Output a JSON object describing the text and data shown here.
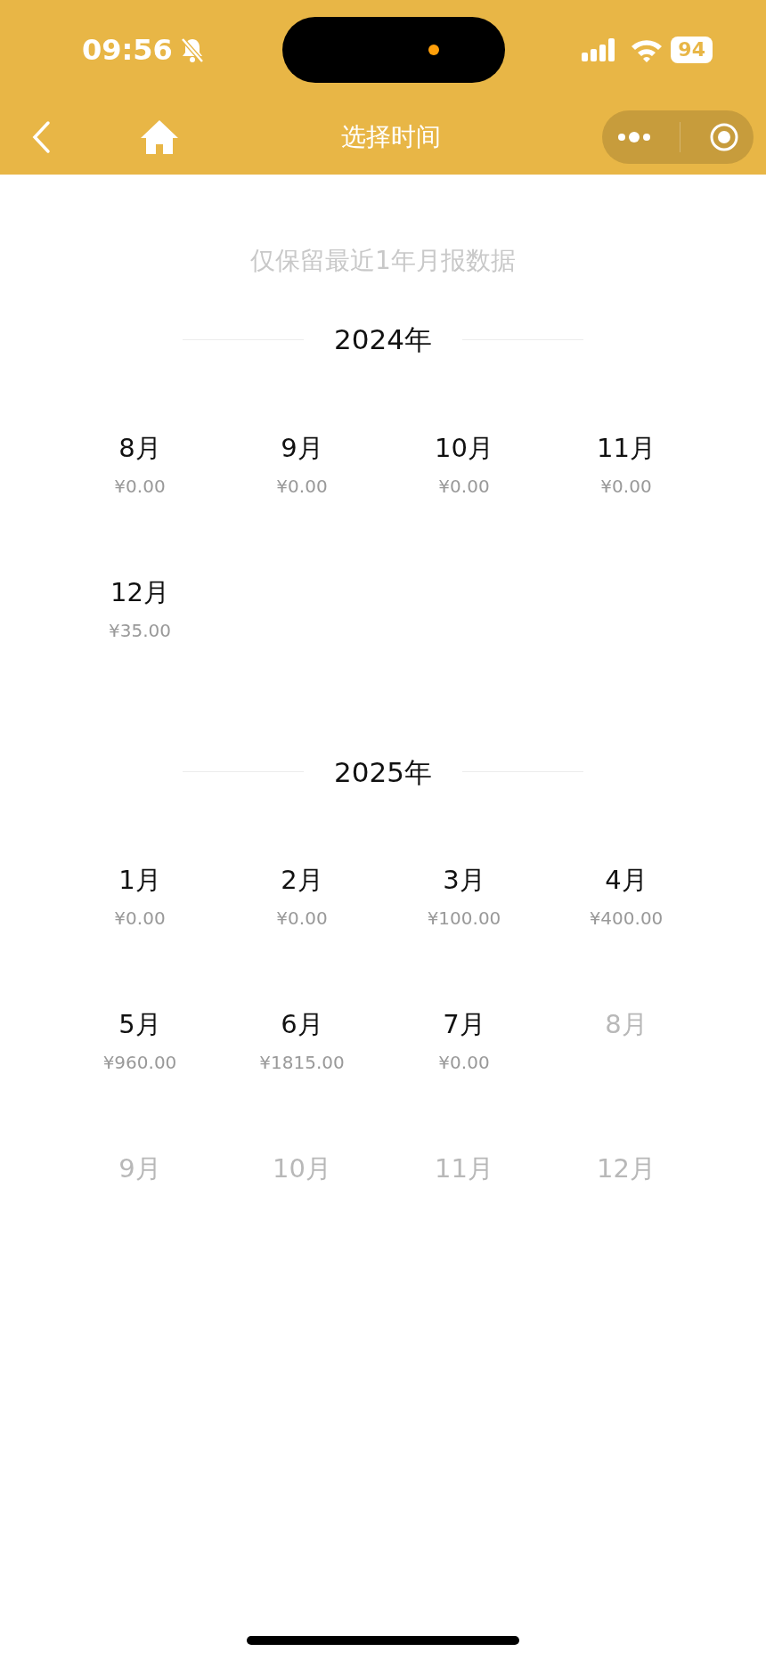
{
  "status_bar": {
    "time": "09:56",
    "battery": "94"
  },
  "nav": {
    "title": "选择时间"
  },
  "notice": "仅保留最近1年月报数据",
  "years": [
    {
      "label": "2024年",
      "months": [
        {
          "label": "8月",
          "amount": "¥0.00",
          "disabled": false
        },
        {
          "label": "9月",
          "amount": "¥0.00",
          "disabled": false
        },
        {
          "label": "10月",
          "amount": "¥0.00",
          "disabled": false
        },
        {
          "label": "11月",
          "amount": "¥0.00",
          "disabled": false
        },
        {
          "label": "12月",
          "amount": "¥35.00",
          "disabled": false
        }
      ]
    },
    {
      "label": "2025年",
      "months": [
        {
          "label": "1月",
          "amount": "¥0.00",
          "disabled": false
        },
        {
          "label": "2月",
          "amount": "¥0.00",
          "disabled": false
        },
        {
          "label": "3月",
          "amount": "¥100.00",
          "disabled": false
        },
        {
          "label": "4月",
          "amount": "¥400.00",
          "disabled": false
        },
        {
          "label": "5月",
          "amount": "¥960.00",
          "disabled": false
        },
        {
          "label": "6月",
          "amount": "¥1815.00",
          "disabled": false
        },
        {
          "label": "7月",
          "amount": "¥0.00",
          "disabled": false
        },
        {
          "label": "8月",
          "disabled": true
        },
        {
          "label": "9月",
          "disabled": true
        },
        {
          "label": "10月",
          "disabled": true
        },
        {
          "label": "11月",
          "disabled": true
        },
        {
          "label": "12月",
          "disabled": true
        }
      ]
    }
  ]
}
